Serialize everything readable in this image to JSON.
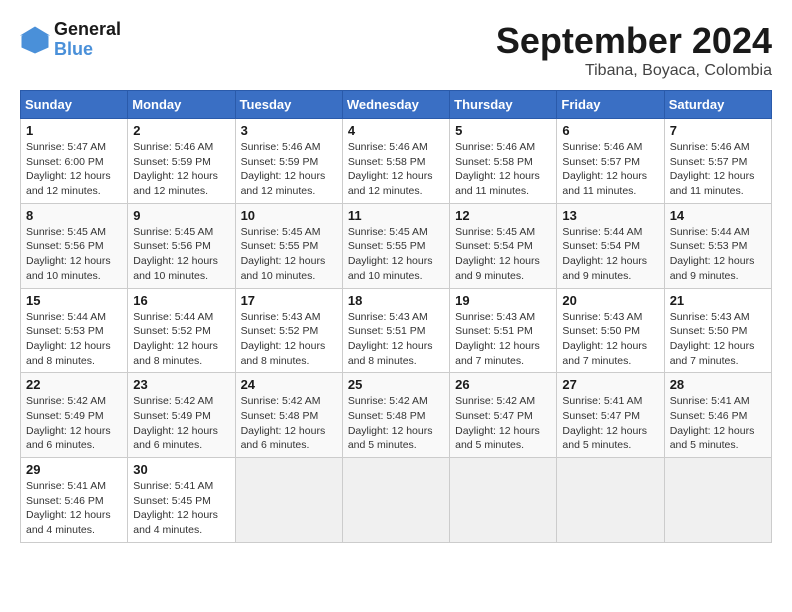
{
  "logo": {
    "line1": "General",
    "line2": "Blue"
  },
  "title": "September 2024",
  "subtitle": "Tibana, Boyaca, Colombia",
  "days_header": [
    "Sunday",
    "Monday",
    "Tuesday",
    "Wednesday",
    "Thursday",
    "Friday",
    "Saturday"
  ],
  "weeks": [
    [
      {
        "day": "1",
        "sunrise": "5:47 AM",
        "sunset": "6:00 PM",
        "daylight": "12 hours and 12 minutes."
      },
      {
        "day": "2",
        "sunrise": "5:46 AM",
        "sunset": "5:59 PM",
        "daylight": "12 hours and 12 minutes."
      },
      {
        "day": "3",
        "sunrise": "5:46 AM",
        "sunset": "5:59 PM",
        "daylight": "12 hours and 12 minutes."
      },
      {
        "day": "4",
        "sunrise": "5:46 AM",
        "sunset": "5:58 PM",
        "daylight": "12 hours and 12 minutes."
      },
      {
        "day": "5",
        "sunrise": "5:46 AM",
        "sunset": "5:58 PM",
        "daylight": "12 hours and 11 minutes."
      },
      {
        "day": "6",
        "sunrise": "5:46 AM",
        "sunset": "5:57 PM",
        "daylight": "12 hours and 11 minutes."
      },
      {
        "day": "7",
        "sunrise": "5:46 AM",
        "sunset": "5:57 PM",
        "daylight": "12 hours and 11 minutes."
      }
    ],
    [
      {
        "day": "8",
        "sunrise": "5:45 AM",
        "sunset": "5:56 PM",
        "daylight": "12 hours and 10 minutes."
      },
      {
        "day": "9",
        "sunrise": "5:45 AM",
        "sunset": "5:56 PM",
        "daylight": "12 hours and 10 minutes."
      },
      {
        "day": "10",
        "sunrise": "5:45 AM",
        "sunset": "5:55 PM",
        "daylight": "12 hours and 10 minutes."
      },
      {
        "day": "11",
        "sunrise": "5:45 AM",
        "sunset": "5:55 PM",
        "daylight": "12 hours and 10 minutes."
      },
      {
        "day": "12",
        "sunrise": "5:45 AM",
        "sunset": "5:54 PM",
        "daylight": "12 hours and 9 minutes."
      },
      {
        "day": "13",
        "sunrise": "5:44 AM",
        "sunset": "5:54 PM",
        "daylight": "12 hours and 9 minutes."
      },
      {
        "day": "14",
        "sunrise": "5:44 AM",
        "sunset": "5:53 PM",
        "daylight": "12 hours and 9 minutes."
      }
    ],
    [
      {
        "day": "15",
        "sunrise": "5:44 AM",
        "sunset": "5:53 PM",
        "daylight": "12 hours and 8 minutes."
      },
      {
        "day": "16",
        "sunrise": "5:44 AM",
        "sunset": "5:52 PM",
        "daylight": "12 hours and 8 minutes."
      },
      {
        "day": "17",
        "sunrise": "5:43 AM",
        "sunset": "5:52 PM",
        "daylight": "12 hours and 8 minutes."
      },
      {
        "day": "18",
        "sunrise": "5:43 AM",
        "sunset": "5:51 PM",
        "daylight": "12 hours and 8 minutes."
      },
      {
        "day": "19",
        "sunrise": "5:43 AM",
        "sunset": "5:51 PM",
        "daylight": "12 hours and 7 minutes."
      },
      {
        "day": "20",
        "sunrise": "5:43 AM",
        "sunset": "5:50 PM",
        "daylight": "12 hours and 7 minutes."
      },
      {
        "day": "21",
        "sunrise": "5:43 AM",
        "sunset": "5:50 PM",
        "daylight": "12 hours and 7 minutes."
      }
    ],
    [
      {
        "day": "22",
        "sunrise": "5:42 AM",
        "sunset": "5:49 PM",
        "daylight": "12 hours and 6 minutes."
      },
      {
        "day": "23",
        "sunrise": "5:42 AM",
        "sunset": "5:49 PM",
        "daylight": "12 hours and 6 minutes."
      },
      {
        "day": "24",
        "sunrise": "5:42 AM",
        "sunset": "5:48 PM",
        "daylight": "12 hours and 6 minutes."
      },
      {
        "day": "25",
        "sunrise": "5:42 AM",
        "sunset": "5:48 PM",
        "daylight": "12 hours and 5 minutes."
      },
      {
        "day": "26",
        "sunrise": "5:42 AM",
        "sunset": "5:47 PM",
        "daylight": "12 hours and 5 minutes."
      },
      {
        "day": "27",
        "sunrise": "5:41 AM",
        "sunset": "5:47 PM",
        "daylight": "12 hours and 5 minutes."
      },
      {
        "day": "28",
        "sunrise": "5:41 AM",
        "sunset": "5:46 PM",
        "daylight": "12 hours and 5 minutes."
      }
    ],
    [
      {
        "day": "29",
        "sunrise": "5:41 AM",
        "sunset": "5:46 PM",
        "daylight": "12 hours and 4 minutes."
      },
      {
        "day": "30",
        "sunrise": "5:41 AM",
        "sunset": "5:45 PM",
        "daylight": "12 hours and 4 minutes."
      },
      null,
      null,
      null,
      null,
      null
    ]
  ],
  "labels": {
    "sunrise": "Sunrise:",
    "sunset": "Sunset:",
    "daylight": "Daylight:"
  }
}
